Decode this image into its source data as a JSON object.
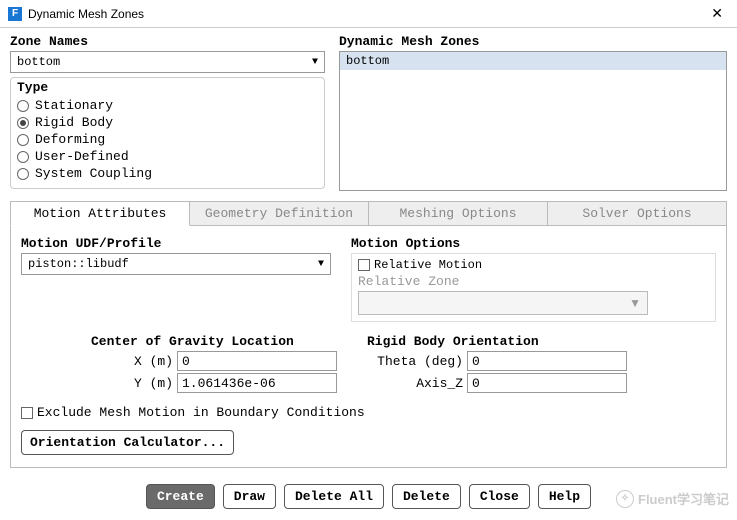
{
  "title": "Dynamic Mesh Zones",
  "zone_names": {
    "label": "Zone Names",
    "value": "bottom"
  },
  "dmz": {
    "label": "Dynamic Mesh Zones",
    "items": [
      "bottom"
    ]
  },
  "type": {
    "label": "Type",
    "options": [
      "Stationary",
      "Rigid Body",
      "Deforming",
      "User-Defined",
      "System Coupling"
    ],
    "selected": "Rigid Body"
  },
  "tabs": {
    "items": [
      "Motion Attributes",
      "Geometry Definition",
      "Meshing Options",
      "Solver Options"
    ],
    "active": "Motion Attributes"
  },
  "motion_udf": {
    "label": "Motion UDF/Profile",
    "value": "piston::libudf"
  },
  "motion_options": {
    "label": "Motion Options",
    "relative_motion": "Relative Motion",
    "relative_zone_label": "Relative Zone",
    "relative_motion_checked": false
  },
  "cog": {
    "label": "Center of Gravity Location",
    "x_label": "X (m)",
    "x_value": "0",
    "y_label": "Y (m)",
    "y_value": "1.061436e-06"
  },
  "rbo": {
    "label": "Rigid Body Orientation",
    "theta_label": "Theta (deg)",
    "theta_value": "0",
    "axisz_label": "Axis_Z",
    "axisz_value": "0"
  },
  "exclude": {
    "label": "Exclude Mesh Motion in Boundary Conditions",
    "checked": false
  },
  "orientation_btn": "Orientation Calculator...",
  "buttons": {
    "create": "Create",
    "draw": "Draw",
    "delete_all": "Delete All",
    "delete": "Delete",
    "close": "Close",
    "help": "Help"
  },
  "watermark": "Fluent学习笔记"
}
